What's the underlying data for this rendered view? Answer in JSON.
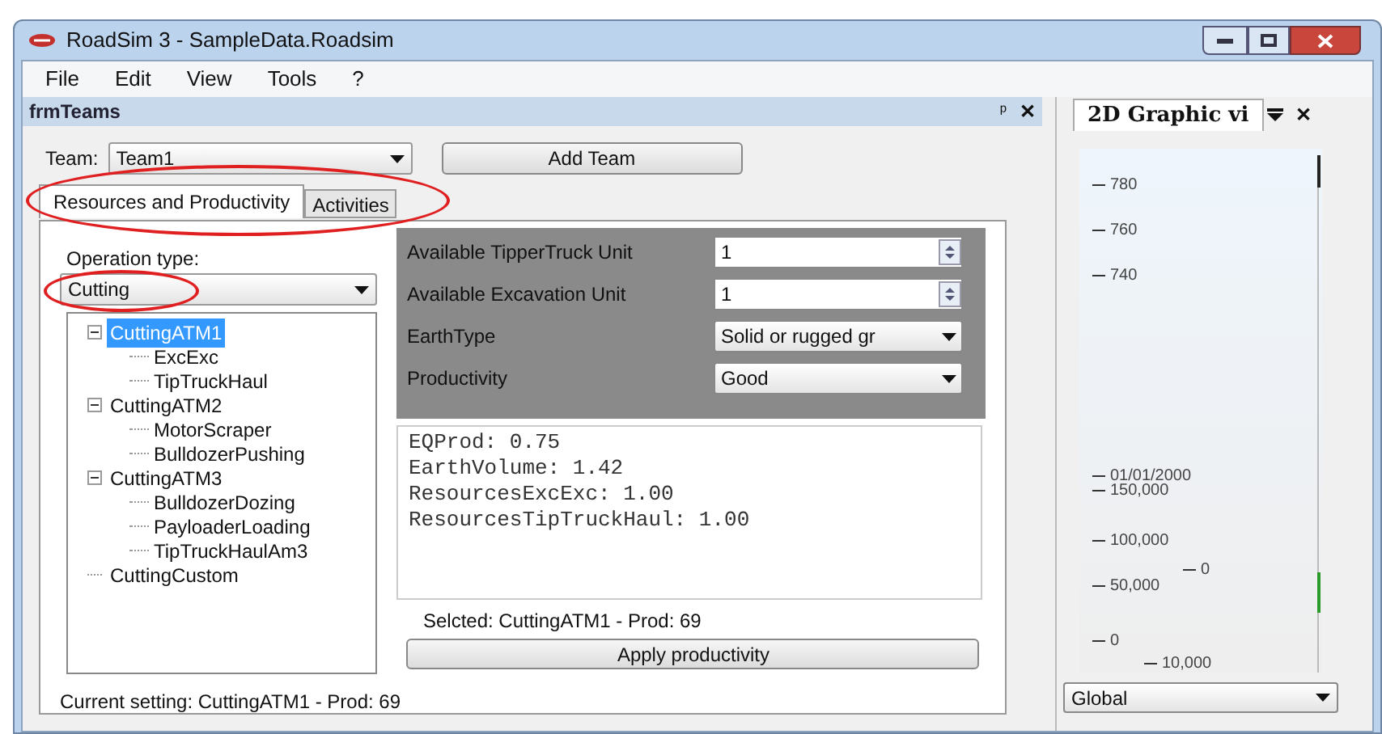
{
  "window": {
    "title": "RoadSim 3 - SampleData.Roadsim"
  },
  "menu": [
    "File",
    "Edit",
    "View",
    "Tools",
    "?"
  ],
  "left_panel": {
    "title": "frmTeams",
    "pin": "ᵖ",
    "close": "✕",
    "team": {
      "label": "Team:",
      "value": "Team1"
    },
    "add_team": "Add Team",
    "tabs": [
      {
        "label": "Resources and Productivity",
        "selected": true,
        "highlighted": true
      },
      {
        "label": "Activities",
        "selected": false,
        "highlighted": false
      }
    ],
    "operation": {
      "label": "Operation type:",
      "value": "Cutting",
      "highlighted": true
    },
    "tree": [
      {
        "label": "CuttingATM1",
        "selected": true,
        "expanded": true,
        "children": [
          {
            "label": "ExcExc",
            "selected": false
          },
          {
            "label": "TipTruckHaul",
            "selected": false
          }
        ]
      },
      {
        "label": "CuttingATM2",
        "selected": false,
        "expanded": true,
        "children": [
          {
            "label": "MotorScraper",
            "selected": false
          },
          {
            "label": "BulldozerPushing",
            "selected": false
          }
        ]
      },
      {
        "label": "CuttingATM3",
        "selected": false,
        "expanded": true,
        "children": [
          {
            "label": "BulldozerDozing",
            "selected": false
          },
          {
            "label": "PayloaderLoading",
            "selected": false
          },
          {
            "label": "TipTruckHaulAm3",
            "selected": false
          }
        ]
      },
      {
        "label": "CuttingCustom",
        "selected": false
      }
    ],
    "fields": [
      {
        "kind": "spin",
        "label": "Available TipperTruck Unit",
        "value": "1"
      },
      {
        "kind": "spin",
        "label": "Available Excavation Unit",
        "value": "1"
      },
      {
        "kind": "combo",
        "label": "EarthType",
        "value": "Solid or rugged gr"
      },
      {
        "kind": "combo",
        "label": "Productivity",
        "value": "Good"
      }
    ],
    "results": [
      "EQProd: 0.75",
      "EarthVolume: 1.42",
      "ResourcesExcExc: 1.00",
      "ResourcesTipTruckHaul: 1.00"
    ],
    "selected_text": "Selcted: CuttingATM1 - Prod: 69",
    "apply": "Apply productivity",
    "current_setting": "Current setting: CuttingATM1 - Prod: 69"
  },
  "right_panel": {
    "tab": "2D Graphic vi",
    "close": "✕",
    "axis_labels": [
      "780",
      "760",
      "740",
      "01/01/2000",
      "150,000",
      "100,000",
      "0",
      "50,000",
      "0",
      "10,000"
    ],
    "view": "Global"
  }
}
